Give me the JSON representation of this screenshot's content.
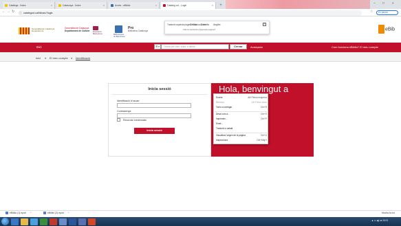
{
  "browser": {
    "tabs": [
      {
        "title": "Catàlegs - Índex"
      },
      {
        "title": "Catalunya - Índex"
      },
      {
        "title": "Accés - eBiblio"
      },
      {
        "title": "Catàleg col - Login",
        "active": true
      }
    ],
    "address": "catalegcol.cat/iii/cas/?login",
    "pause_label": "En pausa"
  },
  "translate_popup": {
    "prompt": "Tradueix aquesta pàgina? Traducció de:",
    "languages": [
      "Català",
      "Castellà",
      "Anglès"
    ],
    "selected_language": "Català",
    "hint": "Vols la traducció d'aquesta pàgina?",
    "close_glyph": "×"
  },
  "logos": {
    "gencat": "Generalitat de Catalunya",
    "gencat_line2": "Departament",
    "dept_line1": "Generalitat de Catalunya",
    "dept_line2": "Departament de Cultura",
    "dipu_line1": "Diputació",
    "dipu_line2": "Barcelona",
    "bib_line1": "Biblioteques",
    "bib_line2": "de Barcelona",
    "biblio_title": "Pro",
    "biblio_sub": "Biblioteca Catalunya",
    "ebiblio": "eBib"
  },
  "nav": {
    "home": "Inici",
    "search_type": "☰ ▾",
    "search_placeholder": "Cerca per títol, autor o altres",
    "search_button": "Cercar",
    "advanced": "Avançada",
    "right_links": "Com funciona eBiblio?   El meu compte"
  },
  "breadcrumb": [
    "Inici",
    "El meu compte",
    "Identificació"
  ],
  "breadcrumb_sep": ">",
  "login": {
    "title": "Inicia sessió",
    "user_label": "Identificació d'usuari",
    "password_label": "Contrasenya",
    "remember_label": "Recordar credencials",
    "submit": "Inicia sessió"
  },
  "welcome_text": "Hola, benvingut a",
  "context_menu": [
    {
      "label": "Enrere",
      "shortcut": "Alt+Fletxa esquerra",
      "disabled": false
    },
    {
      "label": "Reenvia",
      "shortcut": "Alt+Fletxa dreta",
      "disabled": true
    },
    {
      "label": "Torna a carregar",
      "shortcut": "Ctrl+R",
      "disabled": false
    },
    {
      "sep": true
    },
    {
      "label": "Desa com a...",
      "shortcut": "Ctrl+S",
      "disabled": false
    },
    {
      "label": "Imprimeix...",
      "shortcut": "Ctrl+P",
      "disabled": false
    },
    {
      "label": "Emet...",
      "shortcut": "",
      "disabled": false
    },
    {
      "label": "Tradueix a català",
      "shortcut": "",
      "disabled": false
    },
    {
      "sep": true
    },
    {
      "label": "Visualitza l'origen de la pàgina",
      "shortcut": "Ctrl+U",
      "disabled": false
    },
    {
      "label": "Inspecciona",
      "shortcut": "Ctrl+Maj+I",
      "disabled": false
    }
  ],
  "downloads": [
    {
      "name": "eBiblio (1).epub"
    },
    {
      "name": "eBiblio (2).epub"
    }
  ],
  "downloads_show_all": "Mostra-ho tot",
  "tray_time": "▲ ⊡ ◀) ca  10:21",
  "colors": {
    "brand_red": "#c0102a",
    "taskbar": "#18324f"
  }
}
